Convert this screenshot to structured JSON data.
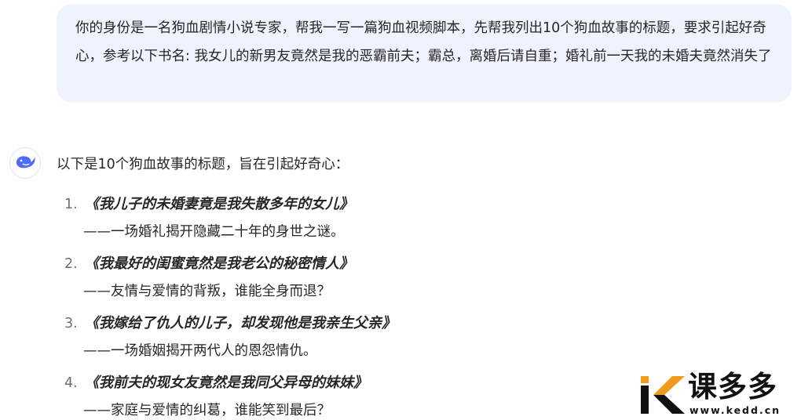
{
  "user_message": {
    "text": "你的身份是一名狗血剧情小说专家，帮我一写一篇狗血视频脚本，先帮我列出10个狗血故事的标题，要求引起好奇心，参考以下书名: 我女儿的新男友竟然是我的恶霸前夫；霸总，离婚后请自重；婚礼前一天我的未婚夫竟然消失了"
  },
  "assistant": {
    "avatar_icon": "whale-logo-icon",
    "intro": "以下是10个狗血故事的标题，旨在引起好奇心：",
    "items": [
      {
        "num": "1.",
        "title": "《我儿子的未婚妻竟是我失散多年的女儿》",
        "sub": "——一场婚礼揭开隐藏二十年的身世之谜。"
      },
      {
        "num": "2.",
        "title": "《我最好的闺蜜竟然是我老公的秘密情人》",
        "sub": "——友情与爱情的背叛，谁能全身而退？"
      },
      {
        "num": "3.",
        "title": "《我嫁给了仇人的儿子，却发现他是我亲生父亲》",
        "sub": "——一场婚姻揭开两代人的恩怨情仇。"
      },
      {
        "num": "4.",
        "title": "《我前夫的现女友竟然是我同父异母的妹妹》",
        "sub": "——家庭与爱情的纠葛，谁能笑到最后？"
      }
    ]
  },
  "watermark": {
    "brand": "课多多",
    "url": "www.kedd.cn",
    "colors": {
      "orange": "#f29a1a",
      "dark": "#111111"
    }
  },
  "colors": {
    "bubble_bg": "#eef3fd",
    "text": "#262626",
    "number": "#6b6f76",
    "accent_blue": "#4d6bfe"
  }
}
